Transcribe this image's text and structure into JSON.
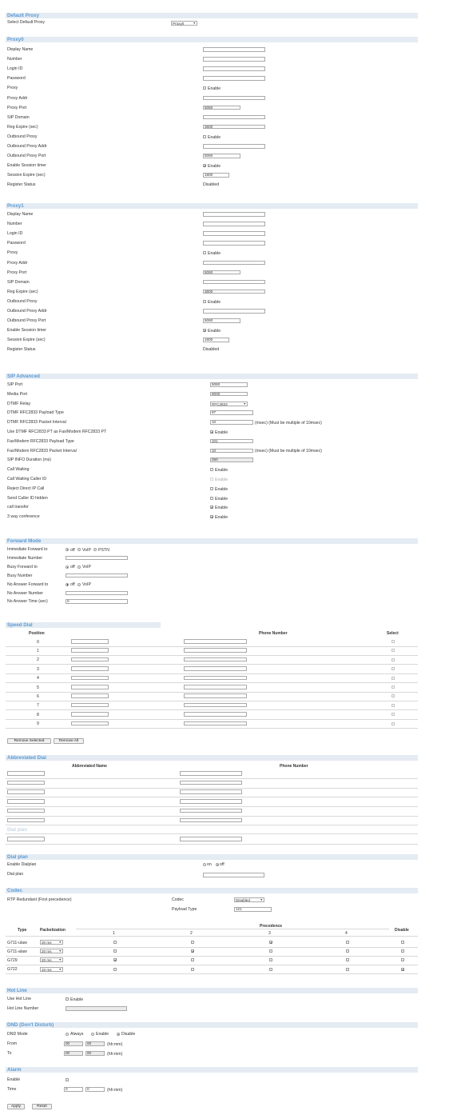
{
  "default_proxy": {
    "title": "Default Proxy",
    "label": "Select Default Proxy",
    "value": "Proxy0"
  },
  "proxy0": {
    "title": "Proxy0",
    "labels": [
      "Display Name",
      "Number",
      "Login ID",
      "Password",
      "Proxy",
      "Proxy Addr",
      "Proxy Port",
      "SIP Domain",
      "Reg Expire (sec)",
      "Outbound Proxy",
      "Outbound Proxy Addr",
      "Outbound Proxy Port",
      "Enable Session timer",
      "Session Expire (sec)",
      "Register Status"
    ],
    "proxy_port": "5060",
    "reg_expire": "3600",
    "outbound_port": "5060",
    "session_expire": "1800",
    "enable": "Enable",
    "register_status": "Disabled"
  },
  "proxy1": {
    "title": "Proxy1",
    "labels": [
      "Display Name",
      "Number",
      "Login ID",
      "Password",
      "Proxy",
      "Proxy Addr",
      "Proxy Port",
      "SIP Domain",
      "Reg Expire (sec)",
      "Outbound Proxy",
      "Outbound Proxy Addr",
      "Outbound Proxy Port",
      "Enable Session timer",
      "Session Expire (sec)",
      "Register Status"
    ],
    "proxy_port": "5060",
    "reg_expire": "3600",
    "outbound_port": "5060",
    "session_expire": "1800",
    "enable": "Enable",
    "register_status": "Disabled"
  },
  "sip_advanced": {
    "title": "SIP Advanced",
    "labels": [
      "SIP Port",
      "Media Port",
      "DTMF Relay",
      "DTMF RFC2833 Payload Type",
      "DTMF RFC2833 Packet Interval",
      "Use DTMF RFC2833 PT as Fax/Modem RFC2833 PT",
      "Fax/Modem RFC2833 Payload Type",
      "Fax/Modem RFC2833 Packet Interval",
      "SIP INFO Duration (ms)",
      "Call Waiting",
      "Call Waiting Caller ID",
      "Reject Direct IP Call",
      "Send Caller ID hidden",
      "call transfer",
      "3 way conference"
    ],
    "sip_port": "5060",
    "media_port": "9000",
    "dtmf_relay": "RFC2833",
    "dtmf_pt": "97",
    "dtmf_interval": "10",
    "interval_note": "(msec) (Must be multiple of 10msec)",
    "fax_pt": "101",
    "fax_interval": "10",
    "info_duration": "250",
    "enable": "Enable"
  },
  "forward_mode": {
    "title": "Forward Mode",
    "labels": [
      "Immediate Forward to",
      "Immediate Number",
      "Busy Forward to",
      "Busy Number",
      "No Answer Forward to",
      "No Answer Number",
      "No Answer Time (sec)"
    ],
    "off": "off",
    "voip": "VoIP",
    "pstn": "PSTN",
    "no_answer_time": "0"
  },
  "speed_dial": {
    "title": "Speed Dial",
    "col_position": "Position",
    "col_phone": "Phone Number",
    "col_select": "Select",
    "positions": [
      "0",
      "1",
      "2",
      "3",
      "4",
      "5",
      "6",
      "7",
      "8",
      "9"
    ],
    "remove_selected": "Remove Selected",
    "remove_all": "Remove All"
  },
  "abbreviated_dial": {
    "title": "Abbreviated Dial",
    "col_name": "Abbreviated Name",
    "col_phone": "Phone Number",
    "faded_title": "Dial plan"
  },
  "dial_plan": {
    "title": "Dial plan",
    "labels": [
      "Enable Dialplan",
      "Dial plan"
    ],
    "on": "on",
    "off": "off"
  },
  "codec": {
    "title": "Codec",
    "rtp_label": "RTP Redundant (First precedence)",
    "codec_label": "Codec",
    "codec_value": "Disabled",
    "payload_label": "Payload Type",
    "payload_value": "121",
    "col_type": "Type",
    "col_packet": "Packetization",
    "col_precedence": "Precedence",
    "col_disable": "Disable",
    "prec_cols": [
      "1",
      "2",
      "3",
      "4"
    ],
    "rows": [
      {
        "type": "G711-ulaw",
        "packet": "20 ms"
      },
      {
        "type": "G711-alaw",
        "packet": "20 ms"
      },
      {
        "type": "G729",
        "packet": "20 ms"
      },
      {
        "type": "G722",
        "packet": "10 ms"
      }
    ]
  },
  "hot_line": {
    "title": "Hot Line",
    "labels": [
      "Use Hot Line",
      "Hot Line Number"
    ],
    "enable": "Enable"
  },
  "dnd": {
    "title": "DND (Don't Disturb)",
    "labels": [
      "DND Mode",
      "From",
      "To"
    ],
    "always": "Always",
    "enable": "Enable",
    "disable": "Disable",
    "from_h": "00",
    "from_m": "00",
    "to_h": "00",
    "to_m": "00",
    "hhmm": "(hh:mm)"
  },
  "alarm": {
    "title": "Alarm",
    "labels": [
      "Enable",
      "Time"
    ],
    "h": "0",
    "m": "0",
    "hhmm": "(hh:mm)"
  },
  "footer": {
    "apply": "Apply",
    "reset": "Reset"
  }
}
